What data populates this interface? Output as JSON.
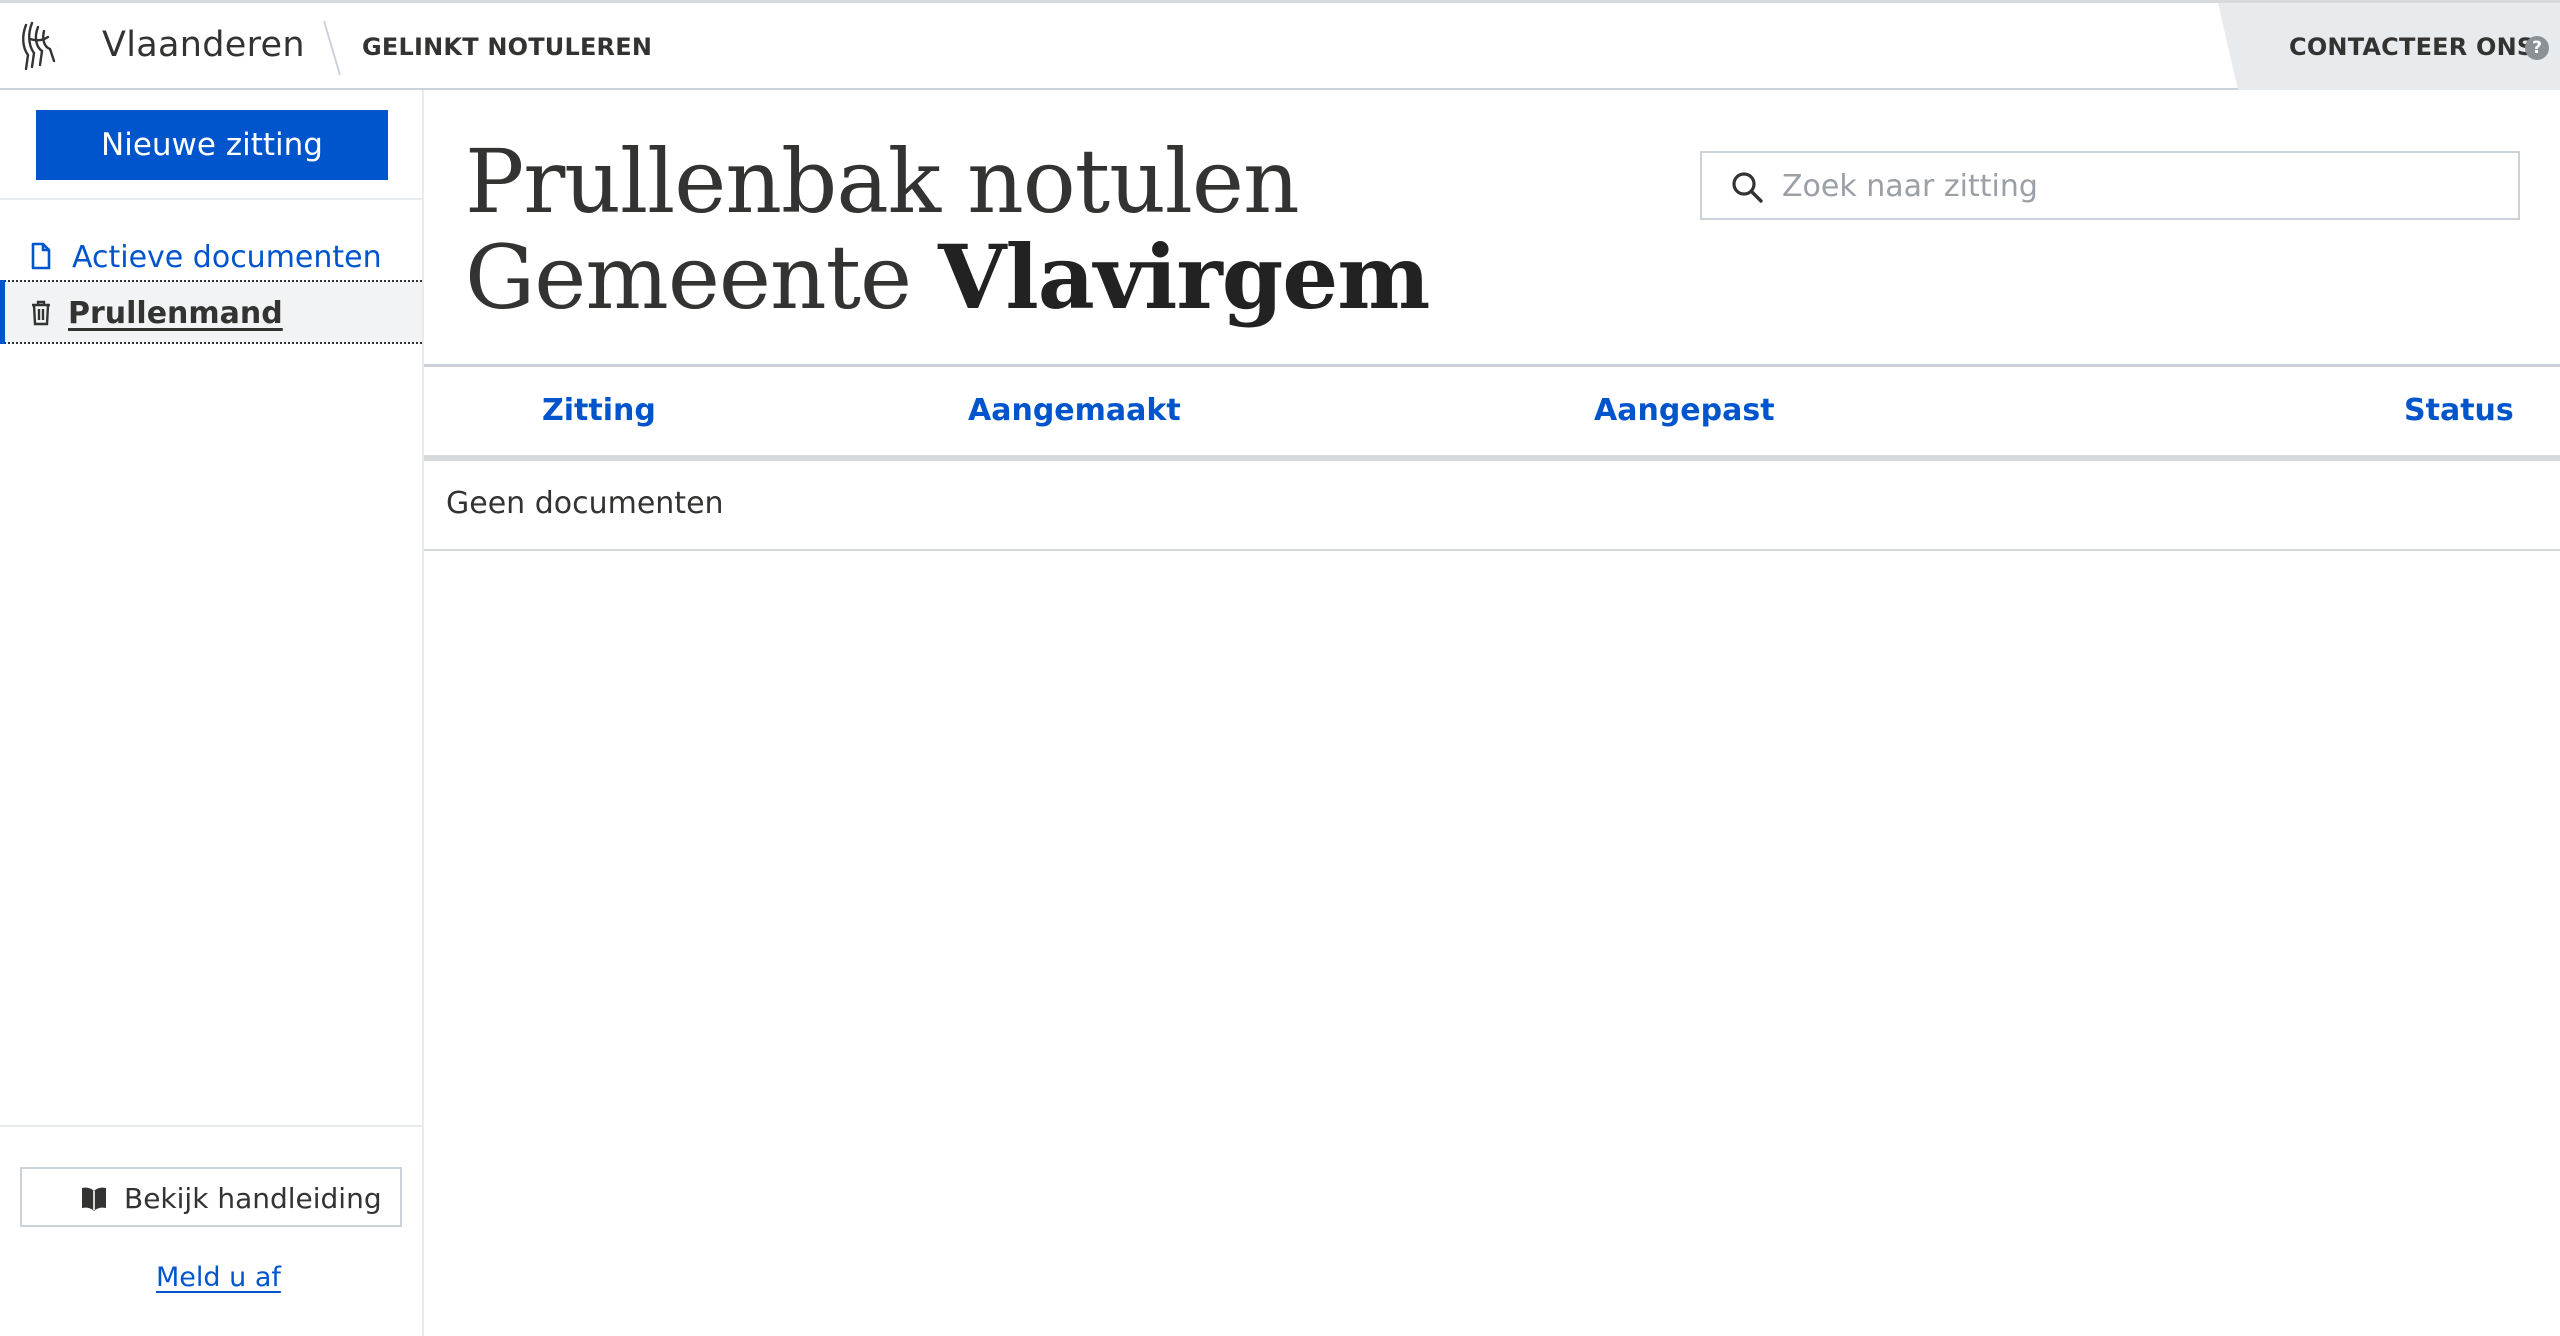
{
  "header": {
    "brand": "Vlaanderen",
    "app_title": "GELINKT NOTULEREN",
    "contact_label": "CONTACTEER ONS",
    "help_glyph": "?",
    "logo_icon": "flemish-lion-logo-icon"
  },
  "sidebar": {
    "new_session_label": "Nieuwe zitting",
    "items": [
      {
        "label": "Actieve documenten",
        "icon": "document-icon",
        "active": false
      },
      {
        "label": "Prullenmand",
        "icon": "trash-icon",
        "active": true
      }
    ],
    "manual_label": "Bekijk handleiding",
    "manual_icon": "book-icon",
    "logout_label": "Meld u af"
  },
  "main": {
    "title_line1": "Prullenbak notulen",
    "title_line2_prefix": "Gemeente ",
    "title_line2_name": "Vlavirgem",
    "search": {
      "placeholder": "Zoek naar zitting",
      "value": "",
      "icon": "search-icon"
    },
    "table": {
      "columns": [
        "Zitting",
        "Aangemaakt",
        "Aangepast",
        "Status"
      ],
      "empty_text": "Geen documenten"
    }
  },
  "colors": {
    "accent": "#0055cc",
    "text": "#333332",
    "border": "#cbd2da",
    "contact_bg": "#e8ebee"
  }
}
